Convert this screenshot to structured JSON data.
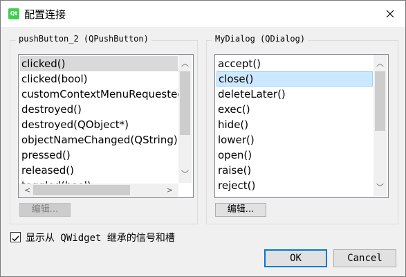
{
  "window": {
    "title": "配置连接",
    "app_icon": "Qt"
  },
  "left_group": {
    "title": "pushButton_2 (QPushButton)",
    "items": [
      "clicked()",
      "clicked(bool)",
      "customContextMenuRequested",
      "destroyed()",
      "destroyed(QObject*)",
      "objectNameChanged(QString)",
      "pressed()",
      "released()",
      "toggled(bool)"
    ],
    "selected_index": 0,
    "edit_label": "编辑..."
  },
  "right_group": {
    "title": "MyDialog (QDialog)",
    "items": [
      "accept()",
      "close()",
      "deleteLater()",
      "exec()",
      "hide()",
      "lower()",
      "open()",
      "raise()",
      "reject()"
    ],
    "selected_index": 1,
    "edit_label": "编辑..."
  },
  "show_inherited": {
    "label": "显示从 QWidget 继承的信号和槽",
    "checked": true
  },
  "buttons": {
    "ok": "OK",
    "cancel": "Cancel"
  },
  "colors": {
    "selection_blue": "#cce8ff",
    "selection_gray": "#d9d9d9",
    "default_border": "#0078d7"
  }
}
